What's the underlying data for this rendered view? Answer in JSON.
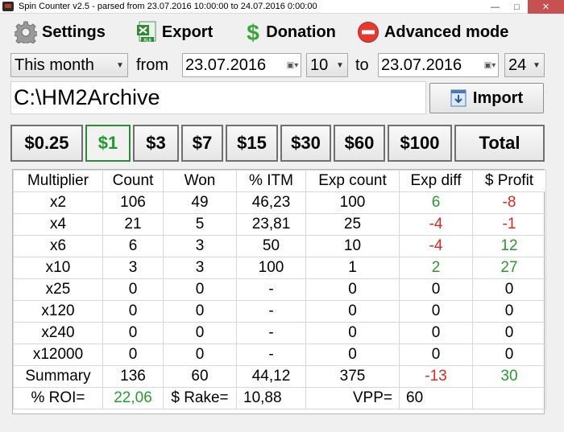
{
  "window": {
    "title": "Spin Counter v2.5 - parsed from 23.07.2016 10:00:00 to 24.07.2016 0:00:00",
    "minimize": "—",
    "maximize": "□",
    "close": "✕"
  },
  "menu": [
    {
      "label": "Settings",
      "icon": "gear-icon"
    },
    {
      "label": "Export",
      "icon": "excel-icon"
    },
    {
      "label": "Donation",
      "icon": "dollar-icon"
    },
    {
      "label": "Advanced mode",
      "icon": "no-entry-icon"
    }
  ],
  "filters": {
    "period": "This month",
    "from_label": "from",
    "from_date": "23.07.2016",
    "from_hour": "10",
    "to_label": "to",
    "to_date": "23.07.2016",
    "to_hour": "24"
  },
  "path": {
    "value": "C:\\HM2Archive",
    "import_label": "Import"
  },
  "stakes": {
    "buttons": [
      "$0.25",
      "$1",
      "$3",
      "$7",
      "$15",
      "$30",
      "$60",
      "$100",
      "Total"
    ],
    "active": "$1"
  },
  "table": {
    "headers": [
      "Multiplier",
      "Count",
      "Won",
      "% ITM",
      "Exp count",
      "Exp diff",
      "$ Profit"
    ],
    "rows": [
      [
        "x2",
        "106",
        "49",
        "46,23",
        "100",
        "6",
        "-8"
      ],
      [
        "x4",
        "21",
        "5",
        "23,81",
        "25",
        "-4",
        "-1"
      ],
      [
        "x6",
        "6",
        "3",
        "50",
        "10",
        "-4",
        "12"
      ],
      [
        "x10",
        "3",
        "3",
        "100",
        "1",
        "2",
        "27"
      ],
      [
        "x25",
        "0",
        "0",
        "-",
        "0",
        "0",
        "0"
      ],
      [
        "x120",
        "0",
        "0",
        "-",
        "0",
        "0",
        "0"
      ],
      [
        "x240",
        "0",
        "0",
        "-",
        "0",
        "0",
        "0"
      ],
      [
        "x12000",
        "0",
        "0",
        "-",
        "0",
        "0",
        "0"
      ],
      [
        "Summary",
        "136",
        "60",
        "44,12",
        "375",
        "-13",
        "30"
      ]
    ],
    "footer": {
      "roi_label": "% ROI=",
      "roi_value": "22,06",
      "rake_label": "$ Rake=",
      "rake_value": "10,88",
      "vpp_label": "VPP=",
      "vpp_value": "60"
    }
  },
  "colors": {
    "positive": "#2a9a2e",
    "negative": "#e52421",
    "close_button": "#c75050"
  }
}
